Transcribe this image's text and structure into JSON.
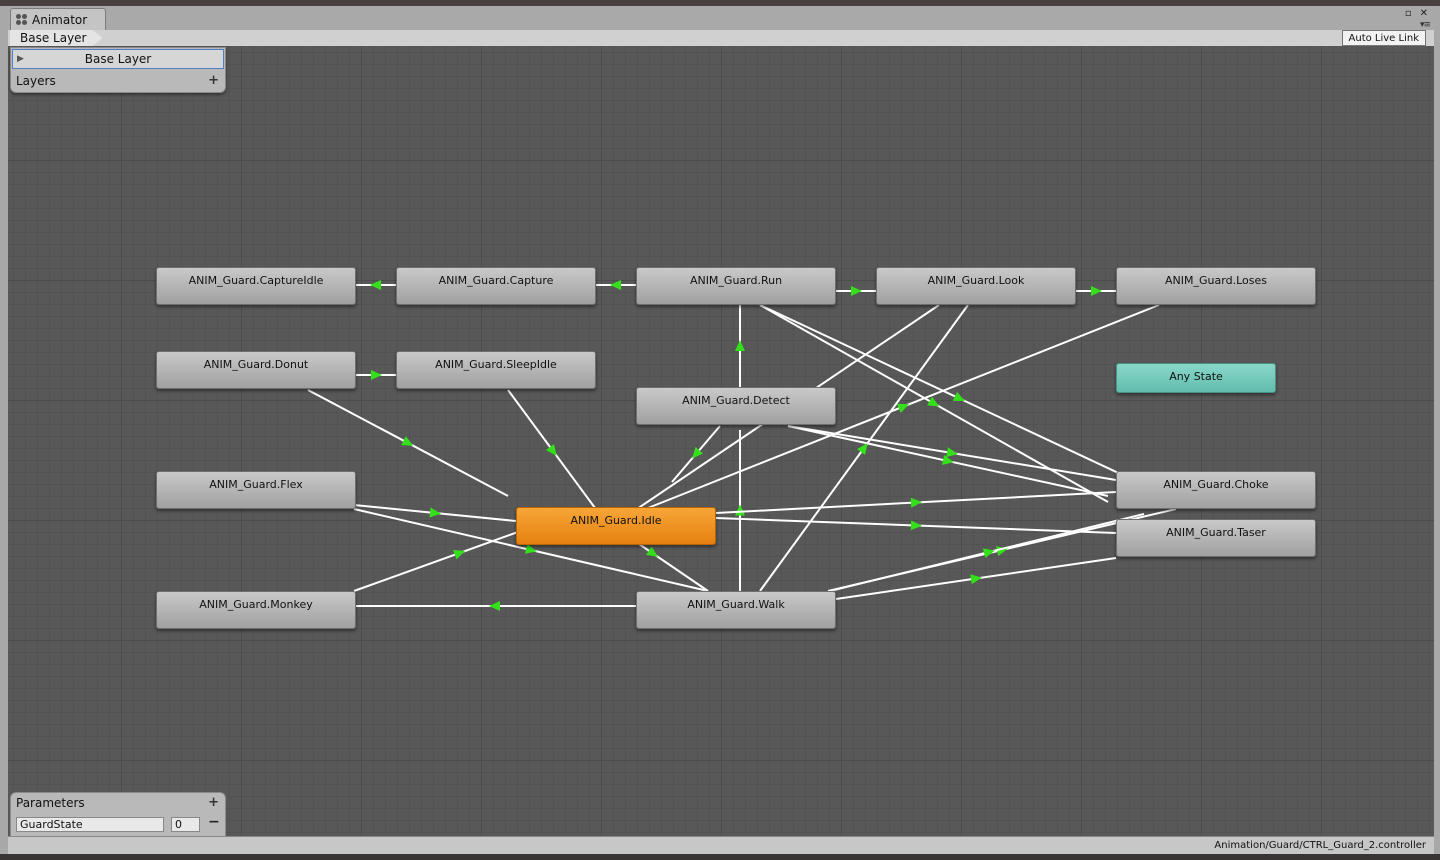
{
  "window": {
    "tab_title": "Animator",
    "maximize_glyph": "▫",
    "close_glyph": "✕",
    "menu_glyph": "▾≡"
  },
  "toolbar": {
    "breadcrumb": "Base Layer",
    "auto_live_link": "Auto Live Link"
  },
  "layers_panel": {
    "expand_glyph": "▶",
    "active_layer": "Base Layer",
    "label": "Layers",
    "add_glyph": "+"
  },
  "states": {
    "capture_idle": "ANIM_Guard.CaptureIdle",
    "capture": "ANIM_Guard.Capture",
    "run": "ANIM_Guard.Run",
    "look": "ANIM_Guard.Look",
    "loses": "ANIM_Guard.Loses",
    "donut": "ANIM_Guard.Donut",
    "sleep_idle": "ANIM_Guard.SleepIdle",
    "detect": "ANIM_Guard.Detect",
    "any_state": "Any State",
    "flex": "ANIM_Guard.Flex",
    "idle": "ANIM_Guard.Idle",
    "choke": "ANIM_Guard.Choke",
    "taser": "ANIM_Guard.Taser",
    "monkey": "ANIM_Guard.Monkey",
    "walk": "ANIM_Guard.Walk"
  },
  "colors": {
    "default_state": "#f39a2a",
    "any_state": "#7acfc1",
    "transition_arrow": "#33e01a",
    "transition_line": "#ffffff"
  },
  "parameters": {
    "label": "Parameters",
    "add_glyph": "+",
    "items": [
      {
        "name": "GuardState",
        "value": "0",
        "remove_glyph": "−"
      }
    ]
  },
  "status": {
    "controller_path": "Animation/Guard/CTRL_Guard_2.controller"
  }
}
